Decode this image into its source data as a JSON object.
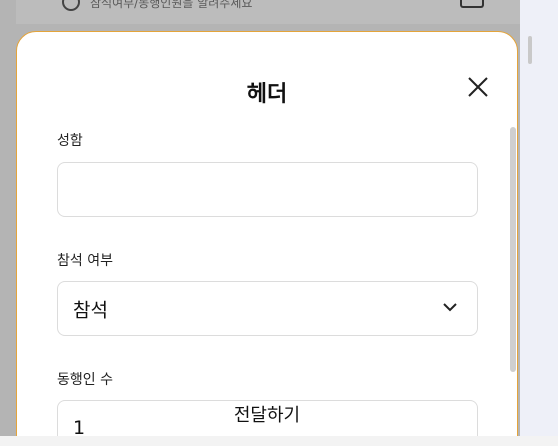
{
  "background": {
    "row_text": "참석여부/동행인원을 알려주세요"
  },
  "modal": {
    "title": "헤더",
    "fields": {
      "name_label": "성함",
      "name_value": "",
      "attendance_label": "참석 여부",
      "attendance_value": "참석",
      "companions_label": "동행인 수",
      "companions_value": "1"
    },
    "submit_label": "전달하기"
  },
  "icons": {
    "close": "close-icon",
    "chevron": "chevron-down-icon"
  },
  "colors": {
    "modal_border": "#e4a43a",
    "overlay": "#b4b4b4",
    "page_bg": "#eef0f8"
  }
}
